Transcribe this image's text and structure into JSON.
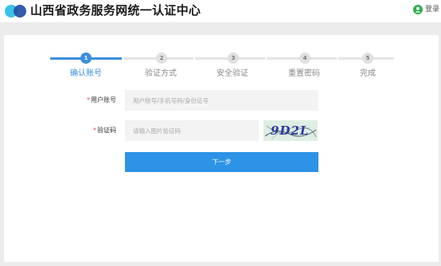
{
  "header": {
    "site_title": "山西省政务服务网统一认证中心",
    "login_label": "登录"
  },
  "steps": [
    {
      "number": "1",
      "label": "确认账号",
      "active": true
    },
    {
      "number": "2",
      "label": "验证方式",
      "active": false
    },
    {
      "number": "3",
      "label": "安全验证",
      "active": false
    },
    {
      "number": "4",
      "label": "重置密码",
      "active": false
    },
    {
      "number": "5",
      "label": "完成",
      "active": false
    }
  ],
  "form": {
    "account": {
      "required_mark": "*",
      "label": "用户账号",
      "placeholder": "用户账号/手机号码/身份证号",
      "value": ""
    },
    "captcha": {
      "required_mark": "*",
      "label": "验证码",
      "placeholder": "请输入图片验证码",
      "value": "",
      "image_text": "9D2L"
    },
    "next_label": "下一步"
  },
  "colors": {
    "accent": "#2d93e6",
    "step_active": "#3b8fdd",
    "required": "#e34b4b",
    "logo_light": "#39c2e6",
    "logo_dark": "#1f4fa3",
    "login_icon": "#2fae4d"
  }
}
